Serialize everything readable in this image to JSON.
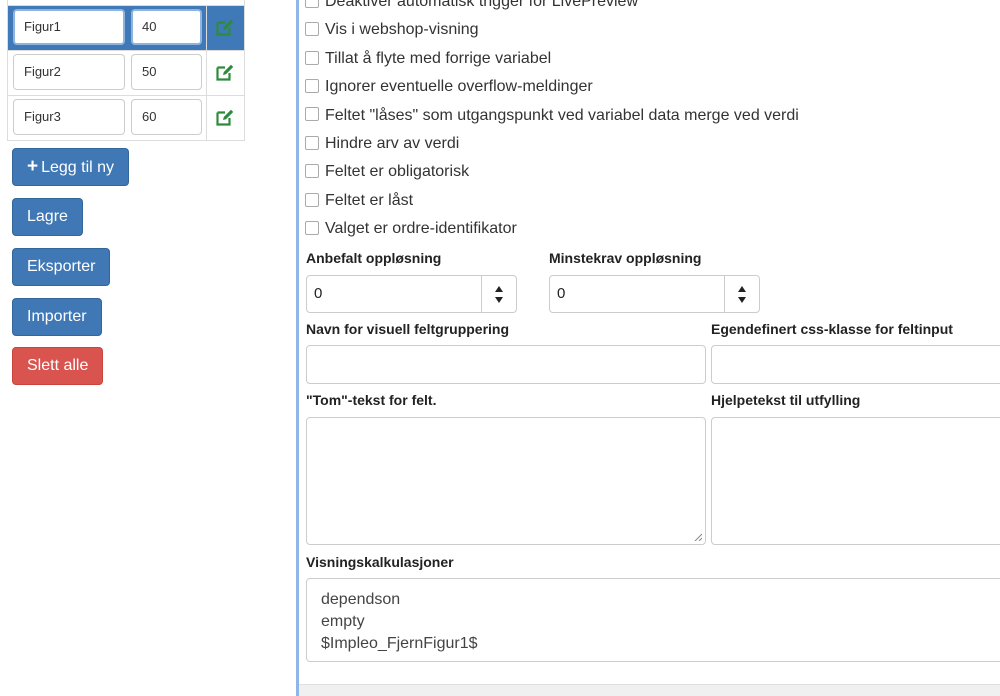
{
  "variables": {
    "rows": [
      {
        "name": "Figur1",
        "value": "40",
        "selected": true
      },
      {
        "name": "Figur2",
        "value": "50",
        "selected": false
      },
      {
        "name": "Figur3",
        "value": "60",
        "selected": false
      }
    ]
  },
  "buttons": {
    "add_new": "Legg til ny",
    "save": "Lagre",
    "export": "Eksporter",
    "import": "Importer",
    "delete_all": "Slett alle"
  },
  "options": [
    "Deaktiver automatisk trigger for LivePreview",
    "Vis i webshop-visning",
    "Tillat å flyte med forrige variabel",
    "Ignorer eventuelle overflow-meldinger",
    "Feltet \"låses\" som utgangspunkt ved variabel data merge ved verdi",
    "Hindre arv av verdi",
    "Feltet er obligatorisk",
    "Feltet er låst",
    "Valget er ordre-identifikator"
  ],
  "resolution": {
    "recommended_label": "Anbefalt oppløsning",
    "recommended_value": "0",
    "minimum_label": "Minstekrav oppløsning",
    "minimum_value": "0"
  },
  "fields": {
    "visual_group_label": "Navn for visuell feltgruppering",
    "css_class_label": "Egendefinert css-klasse for feltinput",
    "empty_text_label": "\"Tom\"-tekst for felt.",
    "help_text_label": "Hjelpetekst til utfylling"
  },
  "calculations": {
    "label": "Visningskalkulasjoner",
    "lines": [
      "dependson",
      "empty",
      "$Impleo_FjernFigur1$"
    ]
  },
  "colors": {
    "primary": "#3f78b5",
    "danger": "#d9534f",
    "selected_row": "#4079b7",
    "edit_icon": "#2e8b3d"
  }
}
